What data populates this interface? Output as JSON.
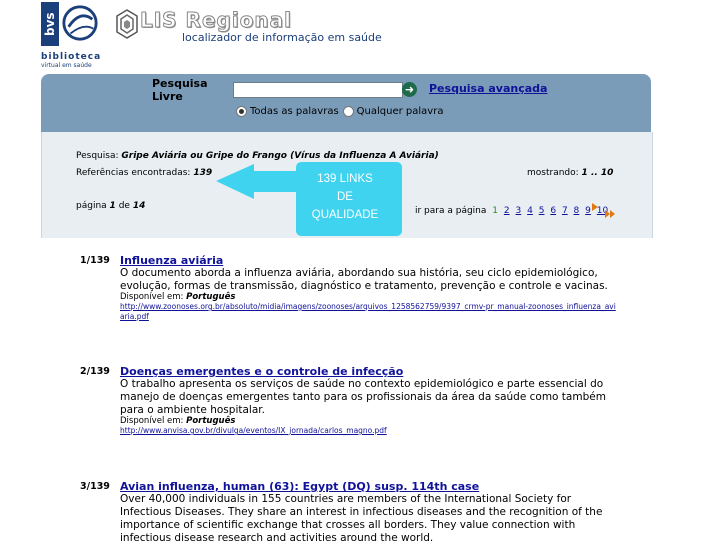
{
  "header": {
    "bvs_mark": "bvs",
    "bvs_name": "biblioteca",
    "bvs_sub": "virtual em saúde",
    "lis_title": "LIS Regional",
    "lis_sub": "localizador de informação em saúde"
  },
  "search": {
    "label": "Pesquisa Livre",
    "input_value": "",
    "go_icon": "arrow-right-icon",
    "advanced_link": "Pesquisa avançada",
    "radio_all": "Todas as palavras",
    "radio_any": "Qualquer palavra",
    "selected": "all"
  },
  "summary": {
    "query_label": "Pesquisa:",
    "query_value": "Gripe Aviária ou Gripe do Frango (Vírus da Influenza A Aviária)",
    "refs_label": "Referências encontradas:",
    "refs_value": "139",
    "showing_label": "mostrando:",
    "showing_value": "1 .. 10",
    "page_label": "página",
    "page_current": "1",
    "page_of": "de",
    "page_total": "14",
    "goto_label": "ir para a página",
    "pages": [
      "1",
      "2",
      "3",
      "4",
      "5",
      "6",
      "7",
      "8",
      "9",
      "10"
    ]
  },
  "callout": {
    "line1": "139 LINKS",
    "line2": "DE",
    "line3": "QUALIDADE",
    "color": "#3fd3f0"
  },
  "results": [
    {
      "num": "1/139",
      "title": "Influenza aviária",
      "desc": "O documento aborda a influenza aviária, abordando sua história, seu ciclo epidemiológico, evolução, formas de transmissão, diagnóstico e tratamento, prevenção e controle e vacinas.",
      "avail_label": "Disponível em:",
      "avail_lang": "Português",
      "url": "http://www.zoonoses.org.br/absoluto/midia/imagens/zoonoses/arquivos_1258562759/9397_crmv-pr_manual-zoonoses_influenza_aviaria.pdf"
    },
    {
      "num": "2/139",
      "title": "Doenças emergentes e o controle de infecção",
      "desc": "O trabalho apresenta os serviços de saúde no contexto epidemiológico e parte essencial do manejo de doenças emergentes tanto para os profissionais da área da saúde como também para o ambiente hospitalar.",
      "avail_label": "Disponível em:",
      "avail_lang": "Português",
      "url": "http://www.anvisa.gov.br/divulga/eventos/IX_jornada/carlos_magno.pdf"
    },
    {
      "num": "3/139",
      "title": "Avian influenza, human (63): Egypt (DQ) susp. 114th case",
      "desc": "Over 40,000 individuals in 155 countries are members of the International Society for Infectious Diseases. They share an interest in infectious diseases and the recognition of the importance of scientific exchange that crosses all borders. They value connection with infectious disease research and activities around the world."
    }
  ]
}
